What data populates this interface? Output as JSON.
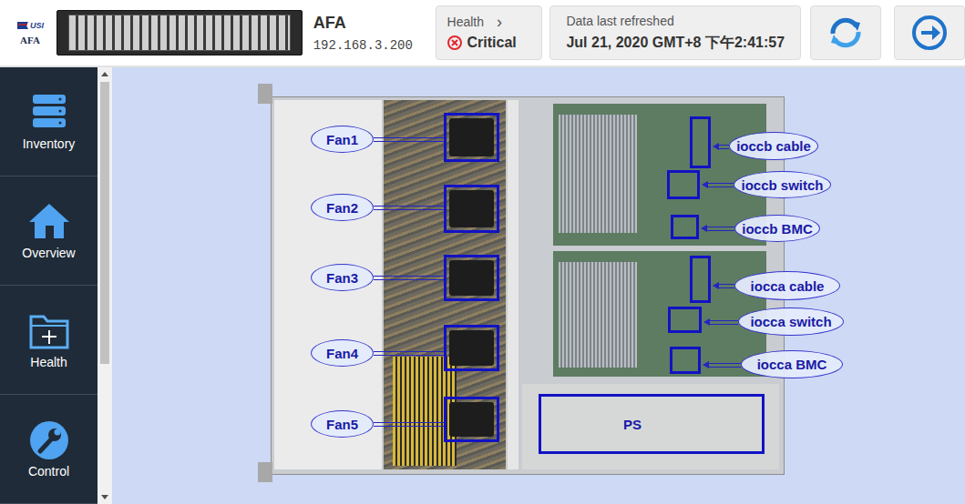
{
  "header": {
    "logo": {
      "brand": "USI",
      "product": "AFA"
    },
    "device": {
      "name": "AFA",
      "ip": "192.168.3.200"
    },
    "health": {
      "label": "Health",
      "chevron": "›",
      "status": "Critical",
      "severity": "critical"
    },
    "refresh": {
      "label": "Data last refreshed",
      "time": "Jul 21, 2020 GMT+8 下午2:41:57"
    }
  },
  "sidebar": {
    "items": [
      {
        "label": "Inventory",
        "selected": false
      },
      {
        "label": "Overview",
        "selected": false
      },
      {
        "label": "Health",
        "selected": false
      },
      {
        "label": "Control",
        "selected": false
      }
    ]
  },
  "diagram": {
    "parts": [
      {
        "label": "Fan1",
        "kind": "fan"
      },
      {
        "label": "Fan2",
        "kind": "fan"
      },
      {
        "label": "Fan3",
        "kind": "fan"
      },
      {
        "label": "Fan4",
        "kind": "fan"
      },
      {
        "label": "Fan5",
        "kind": "fan"
      },
      {
        "label": "ioccb cable",
        "kind": "board"
      },
      {
        "label": "ioccb switch",
        "kind": "board"
      },
      {
        "label": "ioccb BMC",
        "kind": "board"
      },
      {
        "label": "iocca cable",
        "kind": "board"
      },
      {
        "label": "iocca switch",
        "kind": "board"
      },
      {
        "label": "iocca BMC",
        "kind": "board"
      },
      {
        "label": "PS",
        "kind": "inline"
      }
    ]
  }
}
